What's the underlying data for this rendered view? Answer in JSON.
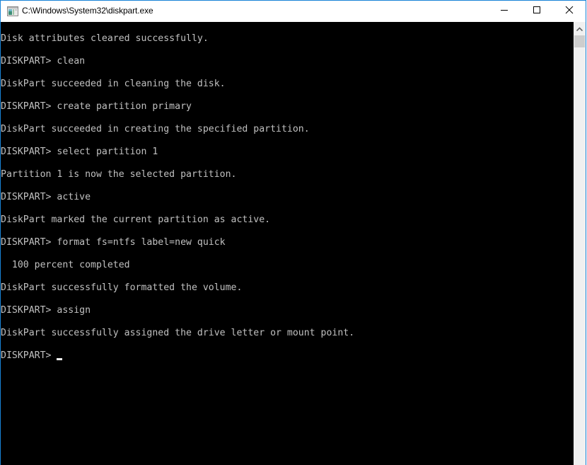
{
  "window": {
    "title": "C:\\Windows\\System32\\diskpart.exe",
    "icon": "console-app-icon",
    "controls": {
      "minimize": "minimize-icon",
      "maximize": "maximize-icon",
      "close": "close-icon"
    }
  },
  "console": {
    "lines": [
      "Disk attributes cleared successfully.",
      "",
      "DISKPART> clean",
      "",
      "DiskPart succeeded in cleaning the disk.",
      "",
      "DISKPART> create partition primary",
      "",
      "DiskPart succeeded in creating the specified partition.",
      "",
      "DISKPART> select partition 1",
      "",
      "Partition 1 is now the selected partition.",
      "",
      "DISKPART> active",
      "",
      "DiskPart marked the current partition as active.",
      "",
      "DISKPART> format fs=ntfs label=new quick",
      "",
      "  100 percent completed",
      "",
      "DiskPart successfully formatted the volume.",
      "",
      "DISKPART> assign",
      "",
      "DiskPart successfully assigned the drive letter or mount point.",
      ""
    ],
    "prompt": "DISKPART> ",
    "current_input": ""
  },
  "colors": {
    "console_background": "#000000",
    "console_text": "#c0c0c0",
    "window_border": "#1883d7"
  }
}
